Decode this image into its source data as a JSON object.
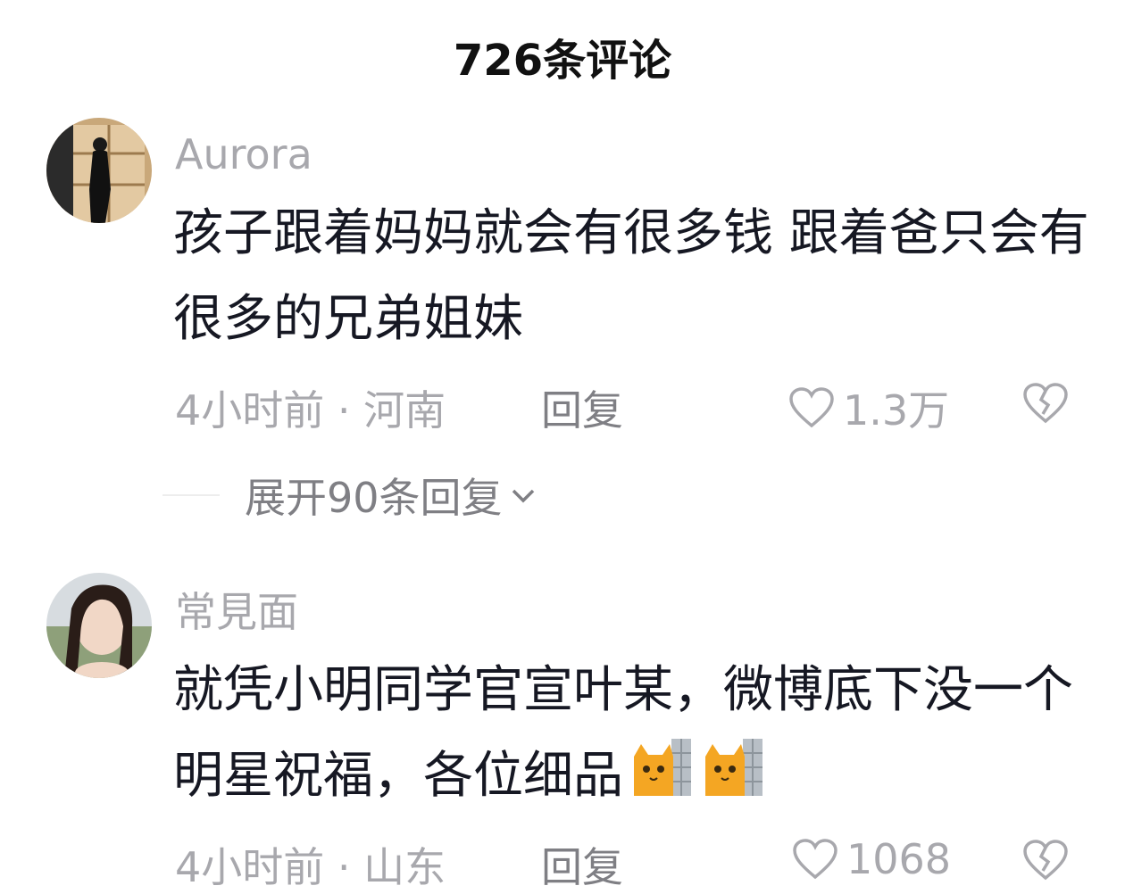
{
  "header": {
    "title": "726条评论"
  },
  "comments": [
    {
      "username": "Aurora",
      "text": "孩子跟着妈妈就会有很多钱 跟着爸只会有很多的兄弟姐妹",
      "time_location": "4小时前 · 河南",
      "reply_label": "回复",
      "likes": "1.3万",
      "expand_label": "展开90条回复"
    },
    {
      "username": "常見面",
      "text": "就凭小明同学官宣叶某，微博底下没一个明星祝福，各位细品",
      "emojis": [
        "cat-peeking-emoji",
        "cat-peeking-emoji"
      ],
      "time_location": "4小时前 · 山东",
      "reply_label": "回复",
      "likes": "1068"
    }
  ],
  "colors": {
    "text": "#161823",
    "muted": "#a8a8ad",
    "reply": "#7f7f84"
  }
}
